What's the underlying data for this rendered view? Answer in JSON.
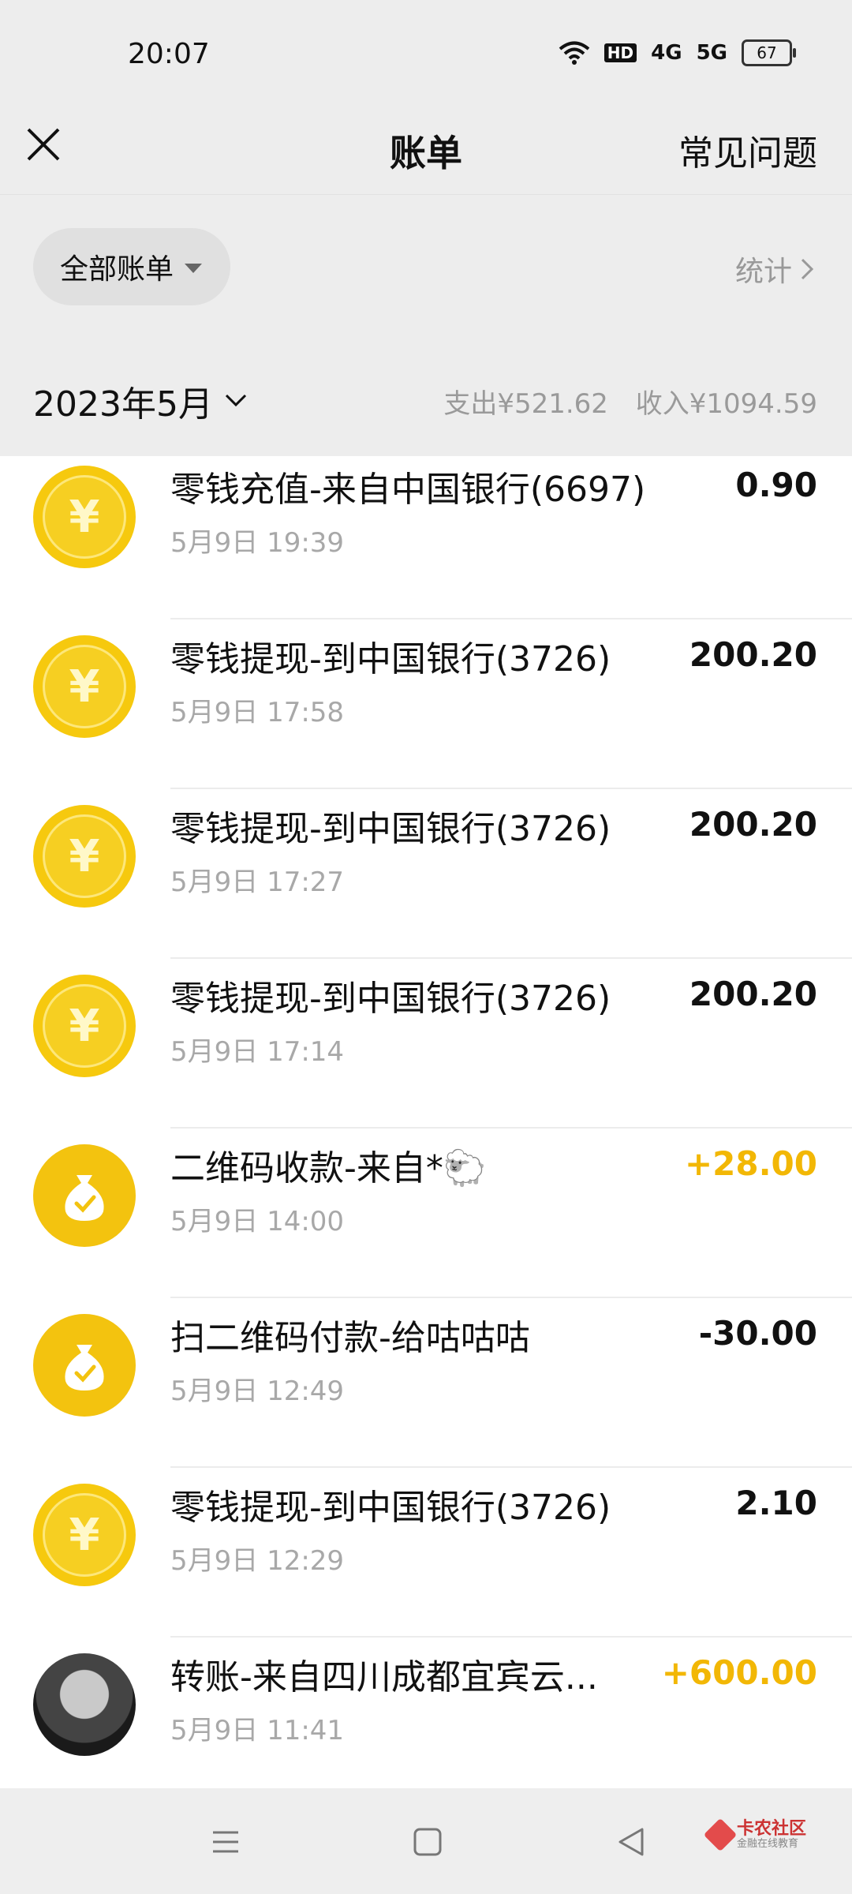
{
  "status_bar": {
    "time": "20:07",
    "network_hd": "HD",
    "network_4g": "4G",
    "network_5g": "5G",
    "battery": "67"
  },
  "header": {
    "title": "账单",
    "faq": "常见问题"
  },
  "filter": {
    "label": "全部账单",
    "stats": "统计"
  },
  "month_bar": {
    "month": "2023年5月",
    "expense": "支出¥521.62",
    "income": "收入¥1094.59"
  },
  "transactions": [
    {
      "icon": "yuan-coin-icon",
      "name": "零钱充值-来自中国银行(6697)",
      "date": "5月9日 19:39",
      "amount": "0.90",
      "income": false
    },
    {
      "icon": "yuan-coin-icon",
      "name": "零钱提现-到中国银行(3726)",
      "date": "5月9日 17:58",
      "amount": "200.20",
      "income": false
    },
    {
      "icon": "yuan-coin-icon",
      "name": "零钱提现-到中国银行(3726)",
      "date": "5月9日 17:27",
      "amount": "200.20",
      "income": false
    },
    {
      "icon": "yuan-coin-icon",
      "name": "零钱提现-到中国银行(3726)",
      "date": "5月9日 17:14",
      "amount": "200.20",
      "income": false
    },
    {
      "icon": "money-bag-icon",
      "name": "二维码收款-来自*🐑",
      "date": "5月9日 14:00",
      "amount": "+28.00",
      "income": true
    },
    {
      "icon": "money-bag-icon",
      "name": "扫二维码付款-给咕咕咕",
      "date": "5月9日 12:49",
      "amount": "-30.00",
      "income": false
    },
    {
      "icon": "yuan-coin-icon",
      "name": "零钱提现-到中国银行(3726)",
      "date": "5月9日 12:29",
      "amount": "2.10",
      "income": false
    },
    {
      "icon": "user-avatar",
      "name": "转账-来自四川成都宜宾云...",
      "date": "5月9日 11:41",
      "amount": "+600.00",
      "income": true
    }
  ],
  "watermark": {
    "title": "卡农社区",
    "subtitle": "金融在线教育"
  },
  "colors": {
    "coin": "#f6c90e",
    "income": "#f2b705",
    "background": "#ededed"
  }
}
